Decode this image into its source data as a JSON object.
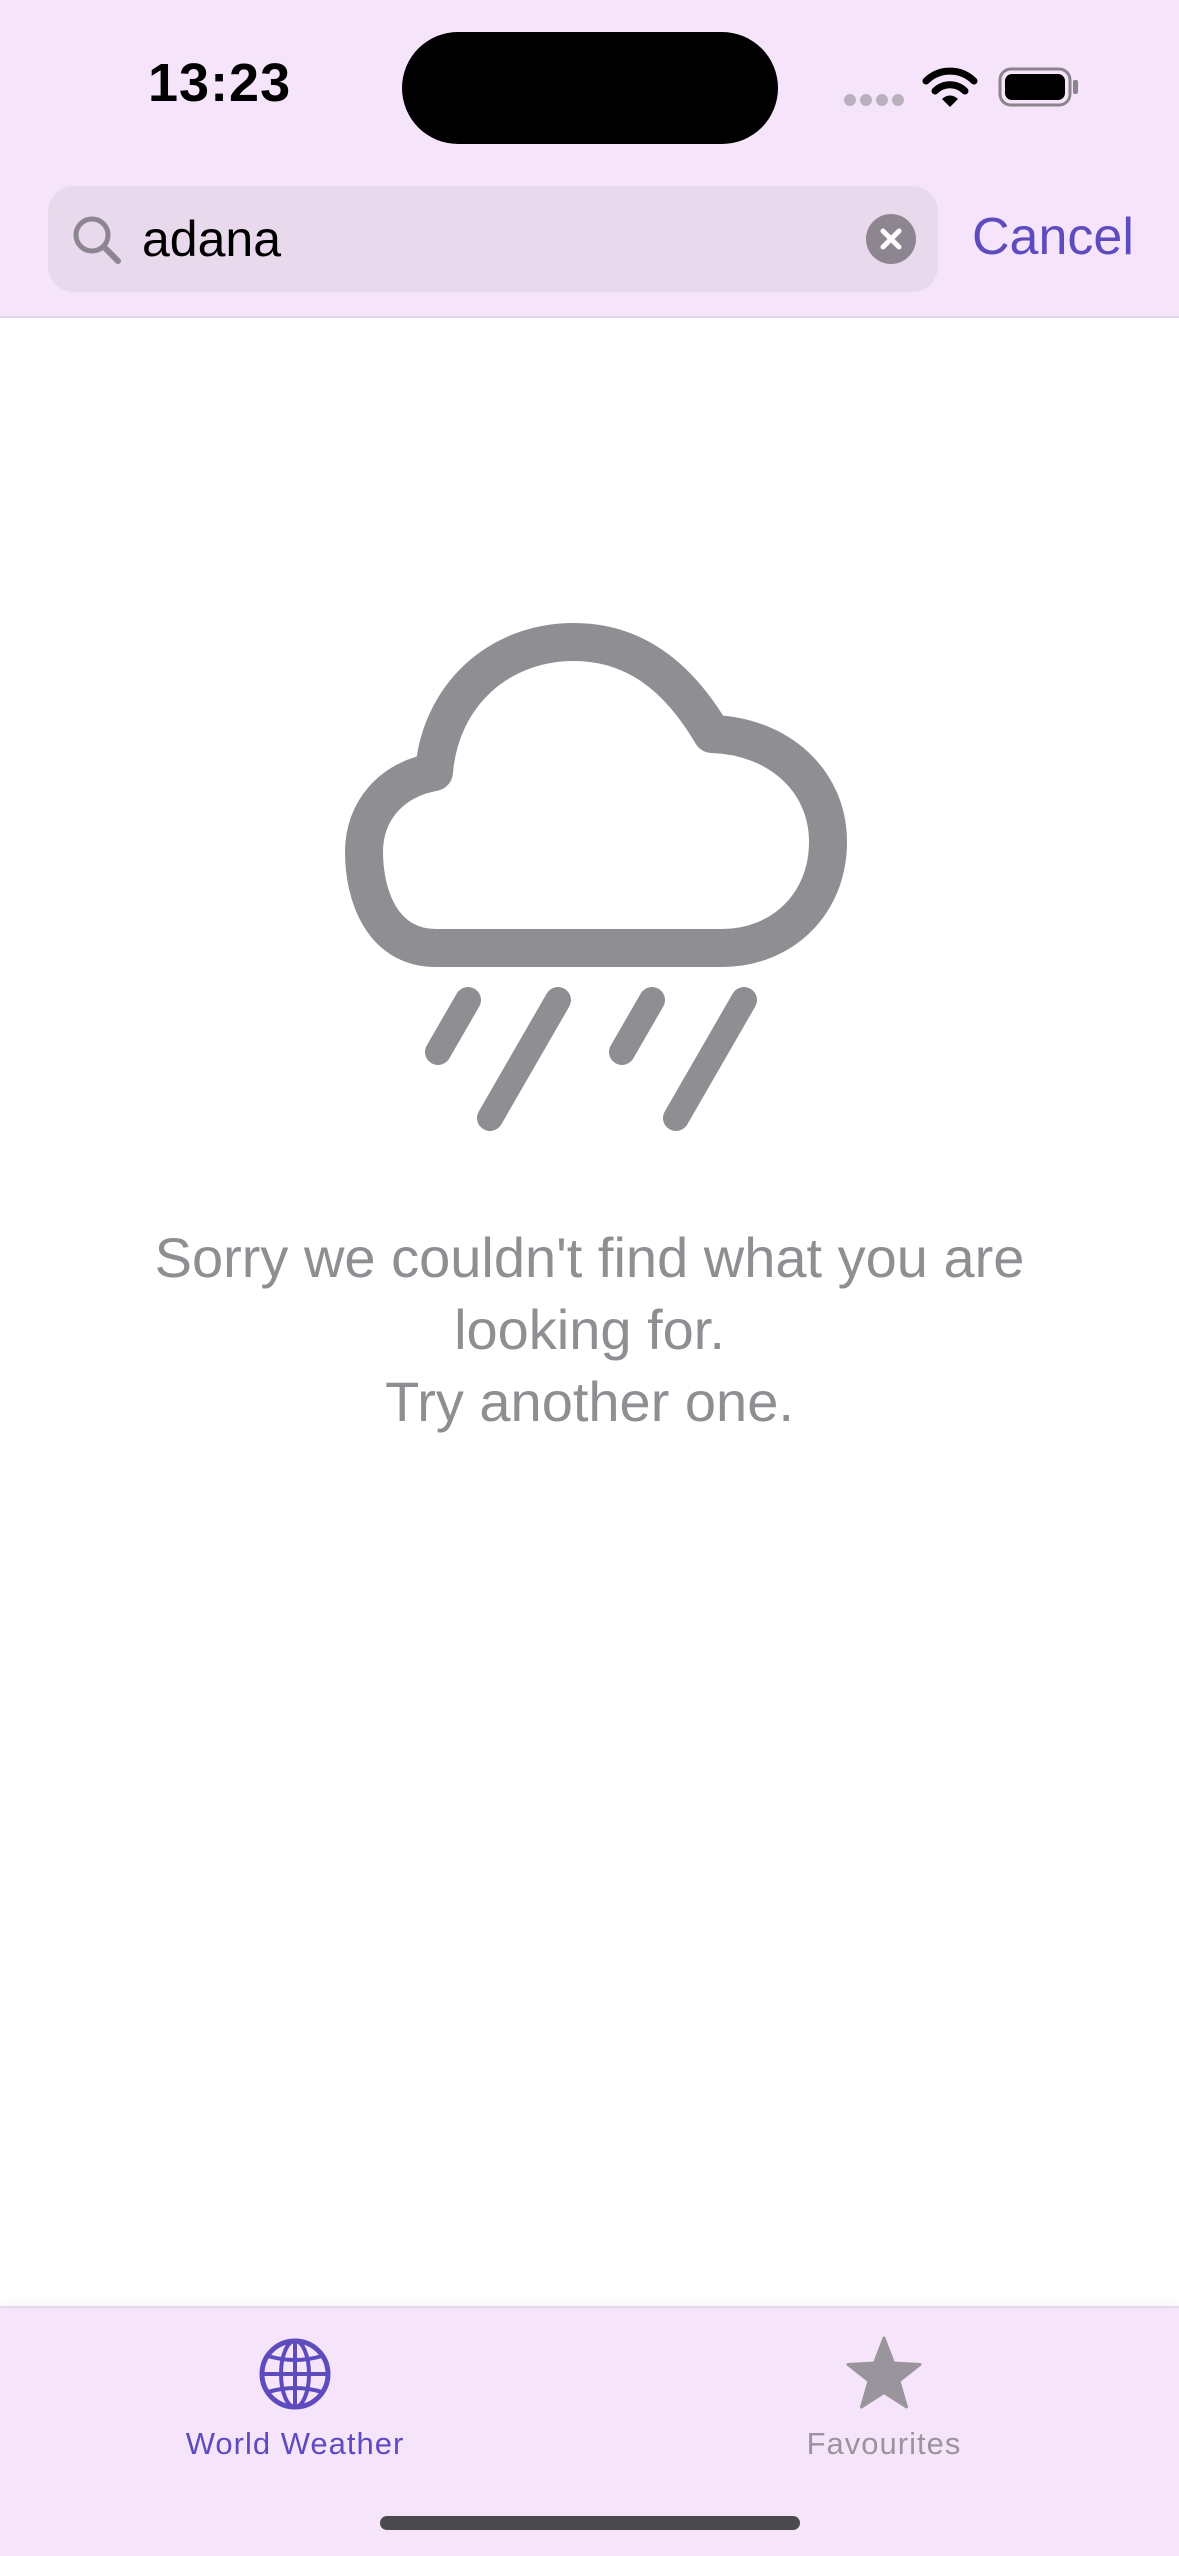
{
  "status_bar": {
    "time": "13:23"
  },
  "search": {
    "value": "adana",
    "cancel_label": "Cancel"
  },
  "empty_state": {
    "icon": "cloud-rain-icon",
    "line1": "Sorry we couldn't find what you are",
    "line2": "looking for.",
    "line3": "Try another one."
  },
  "tab_bar": {
    "tabs": [
      {
        "label": "World Weather",
        "icon": "globe-icon",
        "selected": true
      },
      {
        "label": "Favourites",
        "icon": "star-icon",
        "selected": false
      }
    ]
  },
  "colors": {
    "accent": "#5e4cbf",
    "bar_background": "#f6e4fb",
    "search_background": "#e9d9ec",
    "secondary_text": "#8e8e93",
    "inactive_tab": "#9a959d"
  }
}
